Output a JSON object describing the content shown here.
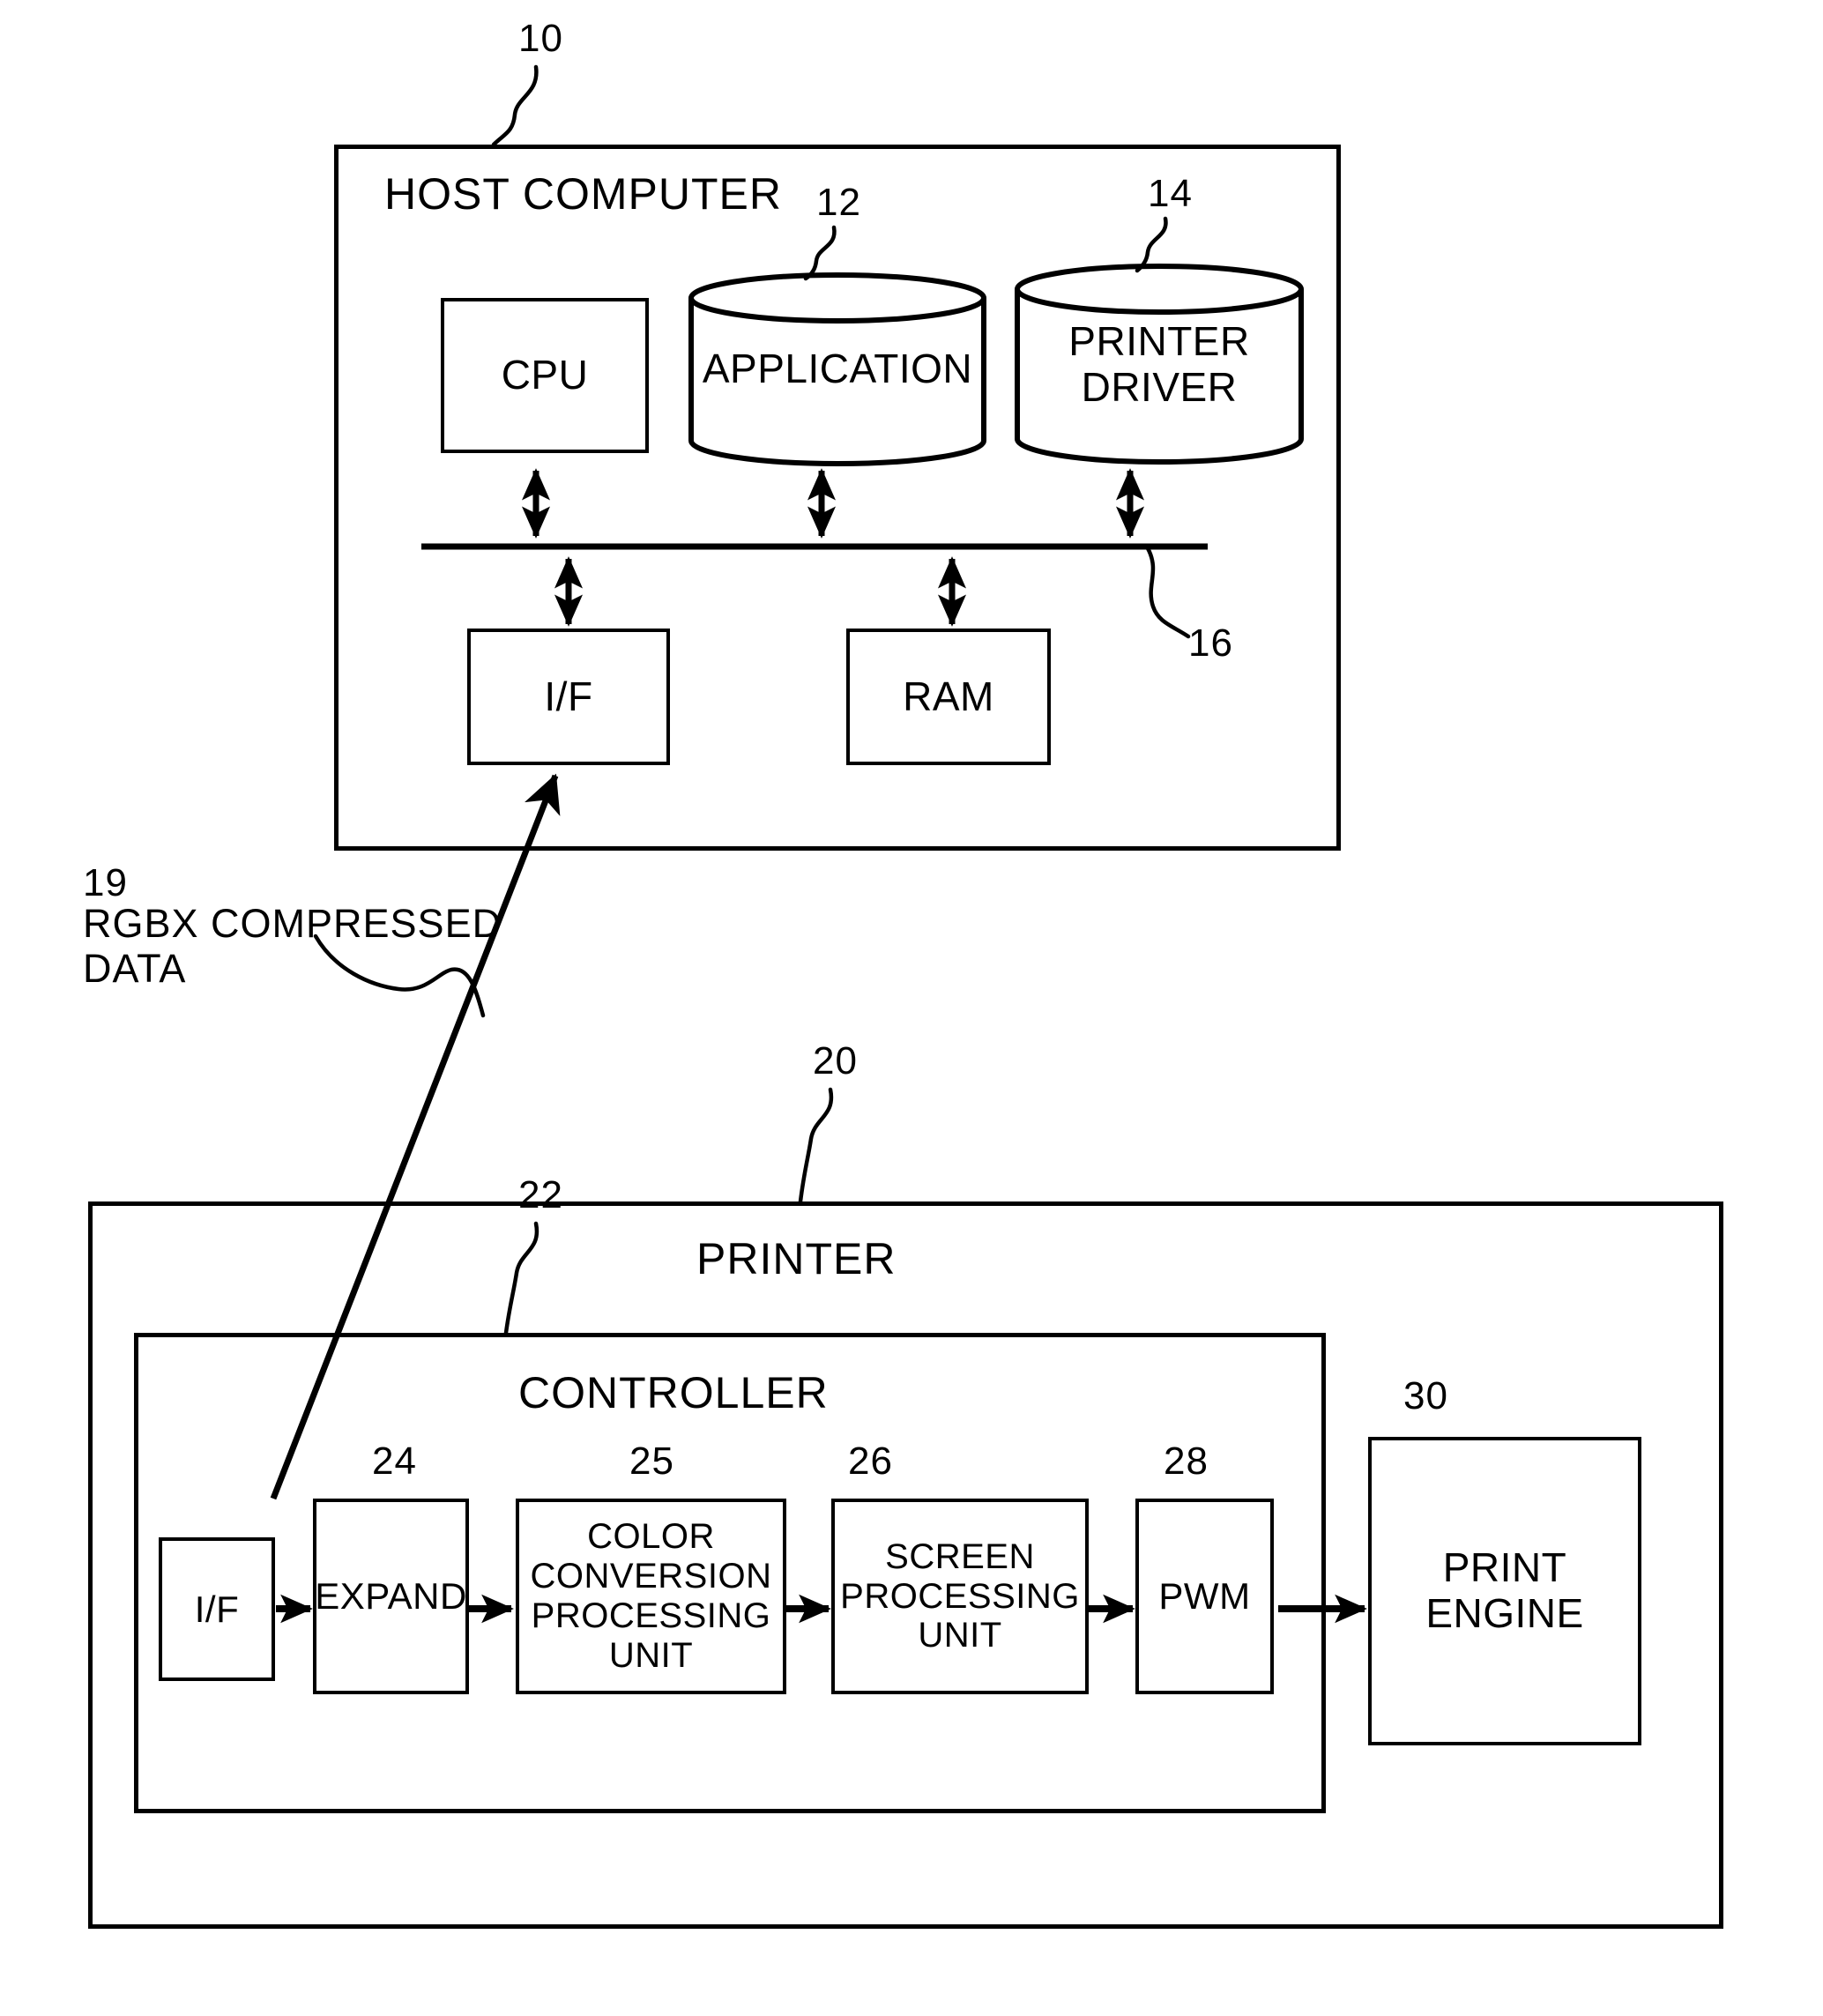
{
  "figure": {
    "type": "patent-block-diagram",
    "host": {
      "title": "HOST COMPUTER",
      "ref": "10",
      "cpu": {
        "label": "CPU"
      },
      "application": {
        "label": "APPLICATION",
        "ref": "12"
      },
      "printer_driver": {
        "label": "PRINTER\nDRIVER",
        "ref": "14"
      },
      "interface": {
        "label": "I/F"
      },
      "ram": {
        "label": "RAM"
      },
      "bus": {
        "ref": "16"
      }
    },
    "link": {
      "ref": "19",
      "label": "RGBX COMPRESSED\nDATA"
    },
    "printer": {
      "title": "PRINTER",
      "ref": "20",
      "controller": {
        "title": "CONTROLLER",
        "ref": "22",
        "interface": {
          "label": "I/F"
        },
        "expand": {
          "label": "EXPAND",
          "ref": "24"
        },
        "color_conversion": {
          "label": "COLOR\nCONVERSION\nPROCESSING\nUNIT",
          "ref": "25"
        },
        "screen_processing": {
          "label": "SCREEN\nPROCESSING\nUNIT",
          "ref": "26"
        },
        "pwm": {
          "label": "PWM",
          "ref": "28"
        }
      },
      "print_engine": {
        "label": "PRINT\nENGINE",
        "ref": "30"
      }
    },
    "colors": {
      "ink": "#000000",
      "paper": "#ffffff"
    }
  }
}
